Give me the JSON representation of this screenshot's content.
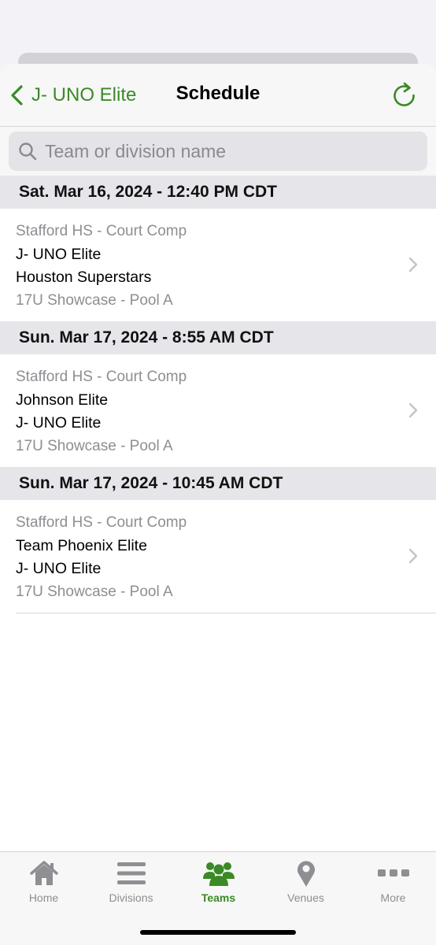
{
  "nav": {
    "back_label": "J- UNO Elite",
    "title": "Schedule"
  },
  "search": {
    "placeholder": "Team or division name"
  },
  "schedule": [
    {
      "date_header": "Sat. Mar 16, 2024 - 12:40 PM CDT",
      "venue": "Stafford HS - Court Comp",
      "team1": "J- UNO Elite",
      "team2": "Houston Superstars",
      "division": "17U Showcase - Pool A"
    },
    {
      "date_header": "Sun. Mar 17, 2024 - 8:55 AM CDT",
      "venue": "Stafford HS - Court Comp",
      "team1": "Johnson Elite",
      "team2": "J- UNO Elite",
      "division": "17U Showcase - Pool A"
    },
    {
      "date_header": "Sun. Mar 17, 2024 - 10:45 AM CDT",
      "venue": "Stafford HS - Court Comp",
      "team1": "Team Phoenix Elite",
      "team2": "J- UNO Elite",
      "division": "17U Showcase - Pool A"
    }
  ],
  "tabbar": {
    "tabs": [
      {
        "label": "Home",
        "icon": "home-icon"
      },
      {
        "label": "Divisions",
        "icon": "list-icon"
      },
      {
        "label": "Teams",
        "icon": "people-icon"
      },
      {
        "label": "Venues",
        "icon": "location-pin-icon"
      },
      {
        "label": "More",
        "icon": "ellipsis-icon"
      }
    ],
    "active": "Teams"
  },
  "colors": {
    "accent": "#3a8a25",
    "inactive": "#8e8e93"
  }
}
